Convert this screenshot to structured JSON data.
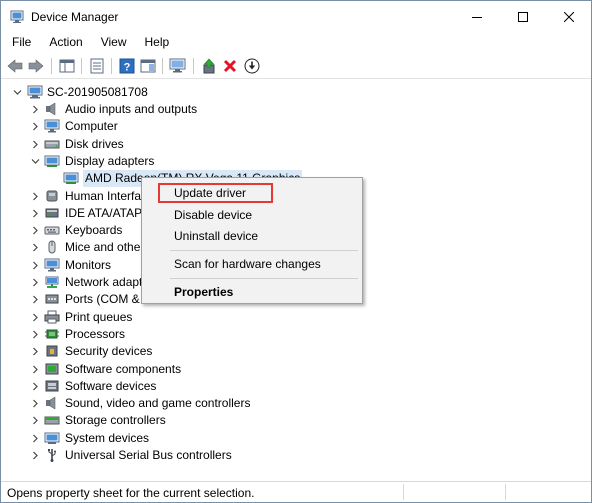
{
  "window": {
    "title": "Device Manager"
  },
  "menu": [
    "File",
    "Action",
    "View",
    "Help"
  ],
  "tree": {
    "root": "SC-201905081708",
    "items": [
      {
        "label": "Audio inputs and outputs",
        "icon": "speaker-icon",
        "expanded": false
      },
      {
        "label": "Computer",
        "icon": "monitor-icon",
        "expanded": false
      },
      {
        "label": "Disk drives",
        "icon": "disk-icon",
        "expanded": false
      },
      {
        "label": "Display adapters",
        "icon": "display-adapter-icon",
        "expanded": true
      },
      {
        "label": "AMD Radeon(TM) RX Vega 11 Graphics",
        "icon": "display-adapter-icon",
        "child": true
      },
      {
        "label": "Human Interfa",
        "icon": "hid-icon",
        "expanded": false
      },
      {
        "label": "IDE ATA/ATAPI",
        "icon": "ide-icon",
        "expanded": false
      },
      {
        "label": "Keyboards",
        "icon": "keyboard-icon",
        "expanded": false
      },
      {
        "label": "Mice and other",
        "icon": "mouse-icon",
        "expanded": false
      },
      {
        "label": "Monitors",
        "icon": "monitor-icon",
        "expanded": false
      },
      {
        "label": "Network adapt",
        "icon": "network-icon",
        "expanded": false
      },
      {
        "label": "Ports (COM &",
        "icon": "ports-icon",
        "expanded": false
      },
      {
        "label": "Print queues",
        "icon": "printer-icon",
        "expanded": false
      },
      {
        "label": "Processors",
        "icon": "processor-icon",
        "expanded": false
      },
      {
        "label": "Security devices",
        "icon": "security-icon",
        "expanded": false
      },
      {
        "label": "Software components",
        "icon": "software-component-icon",
        "expanded": false
      },
      {
        "label": "Software devices",
        "icon": "software-device-icon",
        "expanded": false
      },
      {
        "label": "Sound, video and game controllers",
        "icon": "speaker-icon",
        "expanded": false
      },
      {
        "label": "Storage controllers",
        "icon": "storage-icon",
        "expanded": false
      },
      {
        "label": "System devices",
        "icon": "system-icon",
        "expanded": false
      },
      {
        "label": "Universal Serial Bus controllers",
        "icon": "usb-icon",
        "expanded": false
      }
    ]
  },
  "context_menu": {
    "update": "Update driver",
    "disable": "Disable device",
    "uninstall": "Uninstall device",
    "scan": "Scan for hardware changes",
    "properties": "Properties",
    "highlight_color": "#e53935"
  },
  "status": {
    "text": "Opens property sheet for the current selection."
  },
  "colors": {
    "icon_blue": "#2f6fc0",
    "selection": "#d9e8f7",
    "red_x": "#e81123"
  }
}
